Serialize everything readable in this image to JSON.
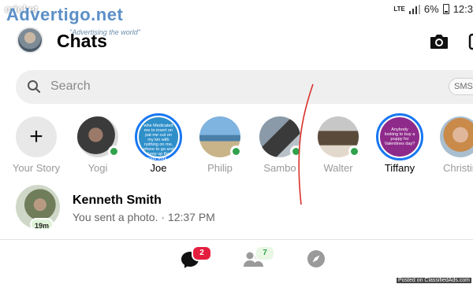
{
  "status_bar": {
    "carrier": "cricket",
    "network": "LTE",
    "battery": "6%",
    "time": "12:3"
  },
  "watermark": {
    "logo": "Advertigo.net",
    "tagline": "\"Advertising the world\""
  },
  "header": {
    "title": "Chats",
    "camera_icon": "camera-icon",
    "edit_icon": "edit-icon"
  },
  "search": {
    "placeholder": "Search",
    "sms_label": "SMS"
  },
  "stories": [
    {
      "name": "Your Story",
      "type": "add",
      "online": false
    },
    {
      "name": "Yogi",
      "online": true,
      "ring": false
    },
    {
      "name": "Joe",
      "online": false,
      "ring": true,
      "text": "whe Medicated me to insert on pat me out on my kin with nothing on me, where to go and keep up the good work..."
    },
    {
      "name": "Philip",
      "online": true,
      "ring": false
    },
    {
      "name": "Sambo",
      "online": true,
      "ring": false
    },
    {
      "name": "Walter",
      "online": true,
      "ring": false
    },
    {
      "name": "Tiffany",
      "online": false,
      "ring": true,
      "text": "Anybody looking to buy a puppy for Valentines day?"
    },
    {
      "name": "Christin",
      "online": false,
      "ring": false
    }
  ],
  "conversation": {
    "name": "Kenneth Smith",
    "preview": "You sent a photo. · 12:37 PM",
    "time_badge": "19m"
  },
  "bottom_nav": {
    "chats_badge": "2",
    "people_badge": "7"
  },
  "credit": "Posted on ClassifiedAds.com",
  "colors": {
    "accent_blue": "#1877f2",
    "online_green": "#31a24c",
    "badge_red": "#e41e3f"
  }
}
